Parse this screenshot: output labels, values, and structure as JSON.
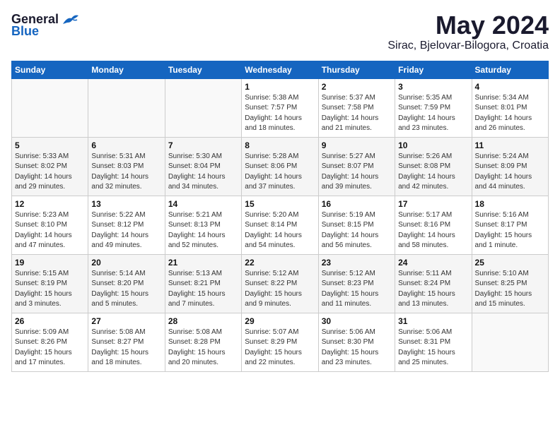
{
  "header": {
    "logo_general": "General",
    "logo_blue": "Blue",
    "month_title": "May 2024",
    "location": "Sirac, Bjelovar-Bilogora, Croatia"
  },
  "weekdays": [
    "Sunday",
    "Monday",
    "Tuesday",
    "Wednesday",
    "Thursday",
    "Friday",
    "Saturday"
  ],
  "weeks": [
    [
      {
        "day": "",
        "info": ""
      },
      {
        "day": "",
        "info": ""
      },
      {
        "day": "",
        "info": ""
      },
      {
        "day": "1",
        "info": "Sunrise: 5:38 AM\nSunset: 7:57 PM\nDaylight: 14 hours\nand 18 minutes."
      },
      {
        "day": "2",
        "info": "Sunrise: 5:37 AM\nSunset: 7:58 PM\nDaylight: 14 hours\nand 21 minutes."
      },
      {
        "day": "3",
        "info": "Sunrise: 5:35 AM\nSunset: 7:59 PM\nDaylight: 14 hours\nand 23 minutes."
      },
      {
        "day": "4",
        "info": "Sunrise: 5:34 AM\nSunset: 8:01 PM\nDaylight: 14 hours\nand 26 minutes."
      }
    ],
    [
      {
        "day": "5",
        "info": "Sunrise: 5:33 AM\nSunset: 8:02 PM\nDaylight: 14 hours\nand 29 minutes."
      },
      {
        "day": "6",
        "info": "Sunrise: 5:31 AM\nSunset: 8:03 PM\nDaylight: 14 hours\nand 32 minutes."
      },
      {
        "day": "7",
        "info": "Sunrise: 5:30 AM\nSunset: 8:04 PM\nDaylight: 14 hours\nand 34 minutes."
      },
      {
        "day": "8",
        "info": "Sunrise: 5:28 AM\nSunset: 8:06 PM\nDaylight: 14 hours\nand 37 minutes."
      },
      {
        "day": "9",
        "info": "Sunrise: 5:27 AM\nSunset: 8:07 PM\nDaylight: 14 hours\nand 39 minutes."
      },
      {
        "day": "10",
        "info": "Sunrise: 5:26 AM\nSunset: 8:08 PM\nDaylight: 14 hours\nand 42 minutes."
      },
      {
        "day": "11",
        "info": "Sunrise: 5:24 AM\nSunset: 8:09 PM\nDaylight: 14 hours\nand 44 minutes."
      }
    ],
    [
      {
        "day": "12",
        "info": "Sunrise: 5:23 AM\nSunset: 8:10 PM\nDaylight: 14 hours\nand 47 minutes."
      },
      {
        "day": "13",
        "info": "Sunrise: 5:22 AM\nSunset: 8:12 PM\nDaylight: 14 hours\nand 49 minutes."
      },
      {
        "day": "14",
        "info": "Sunrise: 5:21 AM\nSunset: 8:13 PM\nDaylight: 14 hours\nand 52 minutes."
      },
      {
        "day": "15",
        "info": "Sunrise: 5:20 AM\nSunset: 8:14 PM\nDaylight: 14 hours\nand 54 minutes."
      },
      {
        "day": "16",
        "info": "Sunrise: 5:19 AM\nSunset: 8:15 PM\nDaylight: 14 hours\nand 56 minutes."
      },
      {
        "day": "17",
        "info": "Sunrise: 5:17 AM\nSunset: 8:16 PM\nDaylight: 14 hours\nand 58 minutes."
      },
      {
        "day": "18",
        "info": "Sunrise: 5:16 AM\nSunset: 8:17 PM\nDaylight: 15 hours\nand 1 minute."
      }
    ],
    [
      {
        "day": "19",
        "info": "Sunrise: 5:15 AM\nSunset: 8:19 PM\nDaylight: 15 hours\nand 3 minutes."
      },
      {
        "day": "20",
        "info": "Sunrise: 5:14 AM\nSunset: 8:20 PM\nDaylight: 15 hours\nand 5 minutes."
      },
      {
        "day": "21",
        "info": "Sunrise: 5:13 AM\nSunset: 8:21 PM\nDaylight: 15 hours\nand 7 minutes."
      },
      {
        "day": "22",
        "info": "Sunrise: 5:12 AM\nSunset: 8:22 PM\nDaylight: 15 hours\nand 9 minutes."
      },
      {
        "day": "23",
        "info": "Sunrise: 5:12 AM\nSunset: 8:23 PM\nDaylight: 15 hours\nand 11 minutes."
      },
      {
        "day": "24",
        "info": "Sunrise: 5:11 AM\nSunset: 8:24 PM\nDaylight: 15 hours\nand 13 minutes."
      },
      {
        "day": "25",
        "info": "Sunrise: 5:10 AM\nSunset: 8:25 PM\nDaylight: 15 hours\nand 15 minutes."
      }
    ],
    [
      {
        "day": "26",
        "info": "Sunrise: 5:09 AM\nSunset: 8:26 PM\nDaylight: 15 hours\nand 17 minutes."
      },
      {
        "day": "27",
        "info": "Sunrise: 5:08 AM\nSunset: 8:27 PM\nDaylight: 15 hours\nand 18 minutes."
      },
      {
        "day": "28",
        "info": "Sunrise: 5:08 AM\nSunset: 8:28 PM\nDaylight: 15 hours\nand 20 minutes."
      },
      {
        "day": "29",
        "info": "Sunrise: 5:07 AM\nSunset: 8:29 PM\nDaylight: 15 hours\nand 22 minutes."
      },
      {
        "day": "30",
        "info": "Sunrise: 5:06 AM\nSunset: 8:30 PM\nDaylight: 15 hours\nand 23 minutes."
      },
      {
        "day": "31",
        "info": "Sunrise: 5:06 AM\nSunset: 8:31 PM\nDaylight: 15 hours\nand 25 minutes."
      },
      {
        "day": "",
        "info": ""
      }
    ]
  ]
}
